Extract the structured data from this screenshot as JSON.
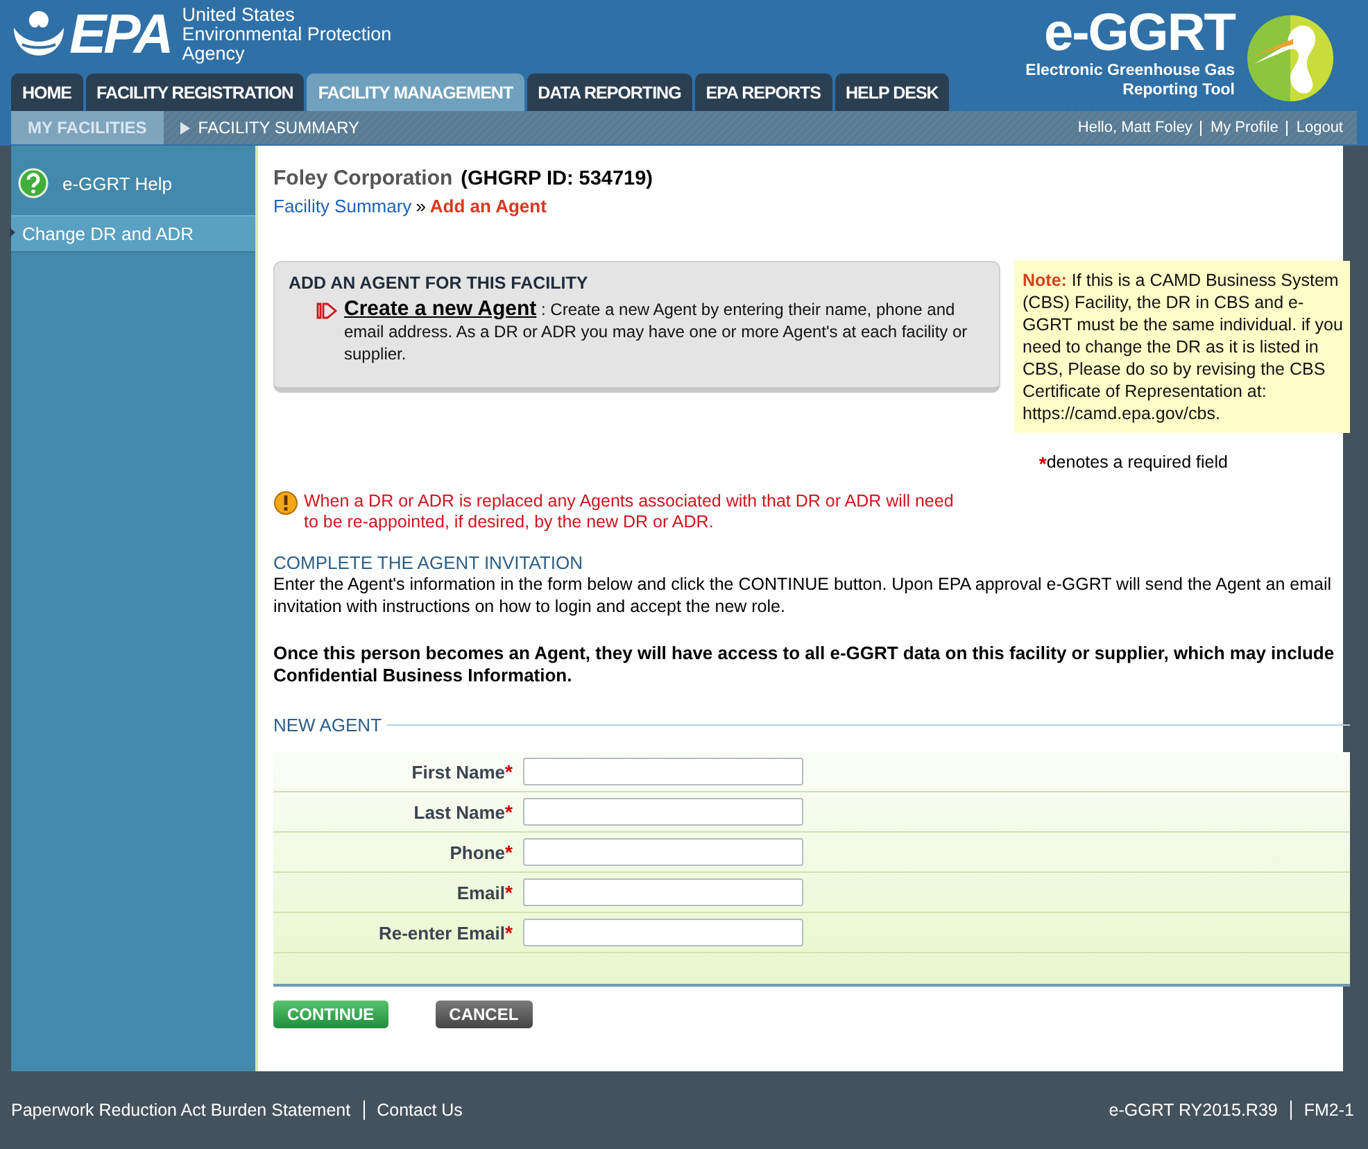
{
  "agency": {
    "logo_text": "EPA",
    "name_lines": [
      "United States",
      "Environmental Protection",
      "Agency"
    ]
  },
  "app": {
    "name": "e-GGRT",
    "subtitle_lines": [
      "Electronic Greenhouse Gas",
      "Reporting Tool"
    ]
  },
  "tabs": [
    {
      "label": "HOME",
      "selected": false
    },
    {
      "label": "FACILITY REGISTRATION",
      "selected": false
    },
    {
      "label": "FACILITY MANAGEMENT",
      "selected": true
    },
    {
      "label": "DATA REPORTING",
      "selected": false
    },
    {
      "label": "EPA REPORTS",
      "selected": false
    },
    {
      "label": "HELP DESK",
      "selected": false
    }
  ],
  "subnav": {
    "items": [
      {
        "label": "MY FACILITIES",
        "selected": true
      },
      {
        "label": "FACILITY SUMMARY",
        "selected": false
      }
    ],
    "greeting": "Hello, Matt Foley",
    "links": [
      "My Profile",
      "Logout"
    ]
  },
  "sidebar": {
    "help": "e-GGRT Help",
    "items": [
      {
        "label": "Change DR and ADR",
        "selected": true
      }
    ]
  },
  "main": {
    "title": "Foley Corporation",
    "id_text": "(GHGRP ID: 534719)",
    "breadcrumb": [
      "Facility Summary"
    ],
    "breadcrumb_sep": "»",
    "current": "Add an Agent",
    "action_box": {
      "heading": "ADD AN AGENT FOR THIS FACILITY",
      "link": "Create a new Agent",
      "separator": ":",
      "text": "Create a new Agent by entering their name, phone and email address.  As a DR or ADR you may have one or more Agent's at each facility or supplier."
    },
    "note": {
      "label": "Note:",
      "text": "If this is a CAMD Business System (CBS) Facility, the DR in CBS and e-GGRT must be the same individual. if you need to change the DR as it is listed in CBS, Please do so by revising the CBS Certificate of Representation at: https://camd.epa.gov/cbs."
    },
    "required_note": {
      "mark": "*",
      "text": "denotes a required field"
    },
    "warning": "When a DR or ADR is replaced any Agents associated with that DR or ADR will need to be re-appointed, if desired, by the new DR or ADR.",
    "section_heading": "COMPLETE THE AGENT INVITATION",
    "instructions": "Enter the Agent's information in the form below and click the CONTINUE button. Upon EPA approval e-GGRT will send the Agent an email invitation with instructions on how to login and accept the new role.",
    "notice": "Once this person becomes an Agent, they will have access to all e-GGRT data on this facility or supplier, which may include Confidential Business Information.",
    "form": {
      "legend": "NEW AGENT",
      "required_mark": "*",
      "fields": [
        {
          "label": "First Name",
          "required": true
        },
        {
          "label": "Last Name",
          "required": true
        },
        {
          "label": "Phone",
          "required": true
        },
        {
          "label": "Email",
          "required": true
        },
        {
          "label": "Re-enter Email",
          "required": true
        }
      ]
    },
    "buttons": [
      {
        "label": "CONTINUE",
        "kind": "primary"
      },
      {
        "label": "CANCEL",
        "kind": "secondary"
      }
    ]
  },
  "footer": {
    "left": [
      "Paperwork Reduction Act Burden Statement",
      "Contact Us"
    ],
    "right": [
      "e-GGRT RY2015.R39",
      "FM2-1"
    ]
  }
}
